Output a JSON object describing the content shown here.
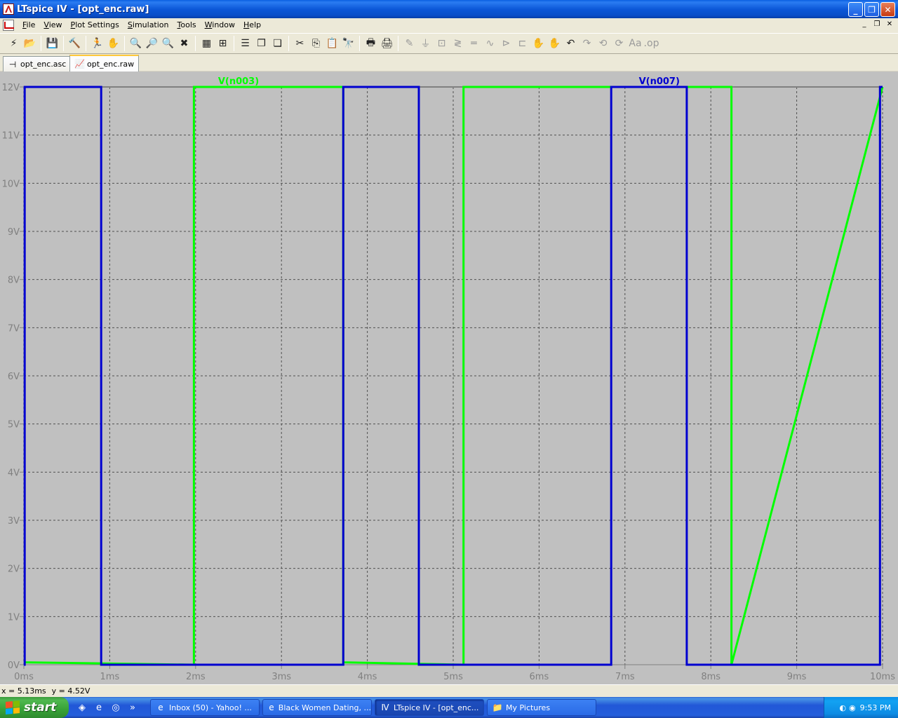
{
  "window": {
    "title": "LTspice IV - [opt_enc.raw]",
    "min_label": "_",
    "max_label": "❐",
    "close_label": "✕"
  },
  "menu": {
    "items": [
      {
        "u": "F",
        "rest": "ile"
      },
      {
        "u": "V",
        "rest": "iew"
      },
      {
        "u": "P",
        "rest": "lot Settings"
      },
      {
        "u": "S",
        "rest": "imulation"
      },
      {
        "u": "T",
        "rest": "ools"
      },
      {
        "u": "W",
        "rest": "indow"
      },
      {
        "u": "H",
        "rest": "elp"
      }
    ],
    "mdi_min": "_",
    "mdi_restore": "❐",
    "mdi_close": "✕"
  },
  "toolbar": {
    "groups": [
      [
        {
          "name": "run-icon",
          "glyph": "⚡"
        },
        {
          "name": "open-icon",
          "glyph": "📂"
        }
      ],
      [
        {
          "name": "save-icon",
          "glyph": "💾"
        }
      ],
      [
        {
          "name": "control-panel-icon",
          "glyph": "🔨"
        }
      ],
      [
        {
          "name": "run-simulation-icon",
          "glyph": "🏃"
        },
        {
          "name": "pan-icon",
          "glyph": "✋",
          "dim": true
        }
      ],
      [
        {
          "name": "zoom-in-icon",
          "glyph": "🔍"
        },
        {
          "name": "zoom-area-icon",
          "glyph": "🔎"
        },
        {
          "name": "zoom-out-icon",
          "glyph": "🔍"
        },
        {
          "name": "zoom-cancel-icon",
          "glyph": "✖"
        }
      ],
      [
        {
          "name": "autorange-icon",
          "glyph": "▦"
        },
        {
          "name": "zoom-full-icon",
          "glyph": "⊞"
        }
      ],
      [
        {
          "name": "tile-horizontal-icon",
          "glyph": "☰"
        },
        {
          "name": "cascade-icon",
          "glyph": "❐"
        },
        {
          "name": "tile-vertical-icon",
          "glyph": "❏"
        }
      ],
      [
        {
          "name": "cut-icon",
          "glyph": "✂"
        },
        {
          "name": "copy-icon",
          "glyph": "⎘"
        },
        {
          "name": "paste-icon",
          "glyph": "📋",
          "dim": true
        },
        {
          "name": "find-icon",
          "glyph": "🔭"
        }
      ],
      [
        {
          "name": "print-setup-icon",
          "glyph": "🖶"
        },
        {
          "name": "print-icon",
          "glyph": "🖨"
        }
      ],
      [
        {
          "name": "wire-icon",
          "glyph": "✎",
          "dim": true
        },
        {
          "name": "ground-icon",
          "glyph": "⏚",
          "dim": true
        },
        {
          "name": "label-icon",
          "glyph": "⊡",
          "dim": true
        },
        {
          "name": "resistor-icon",
          "glyph": "≷",
          "dim": true
        },
        {
          "name": "capacitor-icon",
          "glyph": "═",
          "dim": true
        },
        {
          "name": "inductor-icon",
          "glyph": "∿",
          "dim": true
        },
        {
          "name": "diode-icon",
          "glyph": "⊳",
          "dim": true
        },
        {
          "name": "component-icon",
          "glyph": "⊏",
          "dim": true
        },
        {
          "name": "move-icon",
          "glyph": "✋",
          "dim": true
        },
        {
          "name": "drag-icon",
          "glyph": "✋",
          "dim": true
        },
        {
          "name": "undo-icon",
          "glyph": "↶"
        },
        {
          "name": "redo-icon",
          "glyph": "↷",
          "dim": true
        },
        {
          "name": "rotate-icon",
          "glyph": "⟲",
          "dim": true
        },
        {
          "name": "mirror-icon",
          "glyph": "⟳",
          "dim": true
        },
        {
          "name": "text-icon",
          "glyph": "Aa",
          "dim": true
        },
        {
          "name": "spice-directive-icon",
          "glyph": ".op",
          "dim": true
        }
      ]
    ]
  },
  "tabs": [
    {
      "label": "opt_enc.asc",
      "glyph": "⊣",
      "active": false
    },
    {
      "label": "opt_enc.raw",
      "glyph": "📈",
      "active": true
    }
  ],
  "chart_data": {
    "type": "line",
    "title": "",
    "xlabel": "",
    "ylabel": "",
    "xlim": [
      0,
      10
    ],
    "ylim": [
      0,
      12
    ],
    "x_unit": "ms",
    "y_unit": "V",
    "grid": true,
    "x_ticks": [
      "0ms",
      "1ms",
      "2ms",
      "3ms",
      "4ms",
      "5ms",
      "6ms",
      "7ms",
      "8ms",
      "9ms",
      "10ms"
    ],
    "y_ticks": [
      "0V",
      "1V",
      "2V",
      "3V",
      "4V",
      "5V",
      "6V",
      "7V",
      "8V",
      "9V",
      "10V",
      "11V",
      "12V"
    ],
    "background": "#c0c0c0",
    "grid_color": "#505050",
    "label_color": "#808080",
    "series": [
      {
        "name": "V(n003)",
        "color": "#00ff00",
        "x": [
          0,
          1.98,
          1.98,
          3.72,
          3.72,
          5.12,
          5.12,
          8.24,
          8.24,
          10
        ],
        "y": [
          0.05,
          0.0,
          12,
          12,
          0.05,
          0.0,
          12,
          12,
          0.0,
          12
        ]
      },
      {
        "name": "V(n007)",
        "color": "#0000d0",
        "x": [
          0,
          0.01,
          0.01,
          0.9,
          0.9,
          3.72,
          3.72,
          4.6,
          4.6,
          6.84,
          6.84,
          7.72,
          7.72,
          9.97,
          9.97,
          10
        ],
        "y": [
          0,
          0,
          12,
          12,
          0,
          0,
          12,
          12,
          0,
          0,
          12,
          12,
          0,
          0,
          12,
          12
        ]
      }
    ],
    "legend": [
      "V(n003)",
      "V(n007)"
    ]
  },
  "status": {
    "x": "x = 5.13ms",
    "y": "y = 4.52V"
  },
  "taskbar": {
    "start_label": "start",
    "quicklaunch": [
      "◈",
      "e",
      "◎"
    ],
    "overflow": "»",
    "tasks": [
      {
        "label": "Inbox (50) - Yahoo! ...",
        "glyph": "e",
        "active": false
      },
      {
        "label": "Black Women Dating, ...",
        "glyph": "e",
        "active": false
      },
      {
        "label": "LTspice IV - [opt_enc...",
        "glyph": "Ⅳ",
        "active": true
      },
      {
        "label": "My Pictures",
        "glyph": "📁",
        "active": false
      }
    ],
    "clock": "9:53 PM",
    "tray_icons": [
      "◐",
      "◉"
    ]
  }
}
